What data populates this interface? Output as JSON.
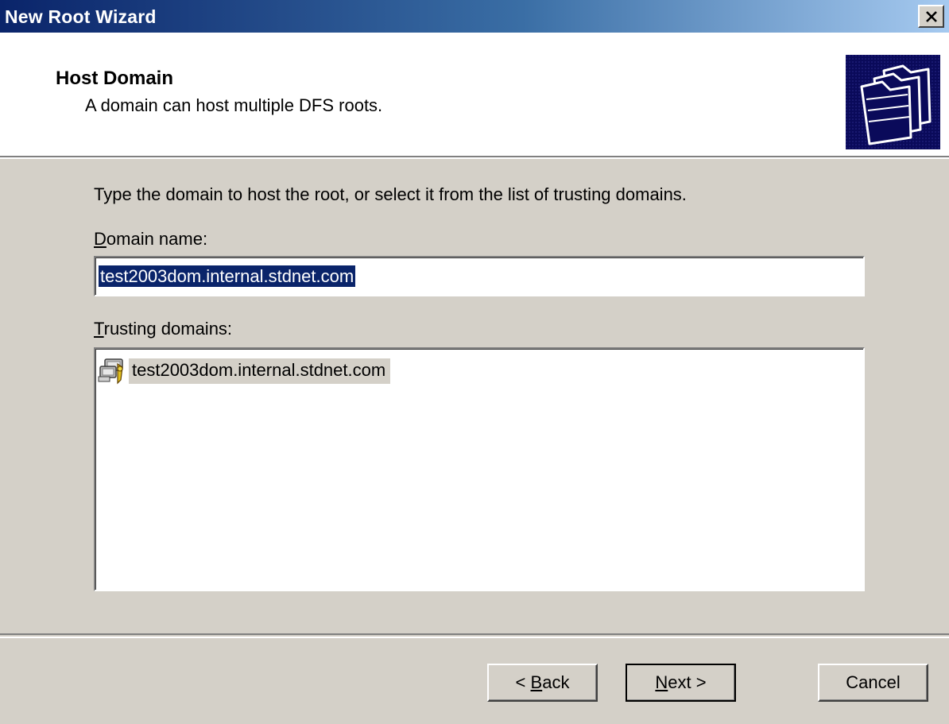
{
  "window": {
    "title": "New Root Wizard",
    "close_glyph": "✕"
  },
  "header": {
    "title": "Host Domain",
    "subtitle": "A domain can host multiple DFS roots.",
    "graphic": "folders-icon"
  },
  "body": {
    "instruction": "Type the domain to host the root, or select it from the list of trusting domains.",
    "domain_name_label": {
      "mnemonic": "D",
      "rest": "omain name:"
    },
    "domain_name_value": "test2003dom.internal.stdnet.com",
    "trusting_label": {
      "mnemonic": "T",
      "rest": "rusting domains:"
    },
    "trusting_domains": [
      {
        "icon": "domain-icon",
        "label": "test2003dom.internal.stdnet.com"
      }
    ]
  },
  "buttons": {
    "back": {
      "prefix": "< ",
      "mnemonic": "B",
      "rest": "ack"
    },
    "next": {
      "mnemonic": "N",
      "rest": "ext >"
    },
    "cancel": "Cancel"
  },
  "colors": {
    "face": "#d4d0c8",
    "titlebar_start": "#0a246a",
    "selection": "#0a246a"
  }
}
